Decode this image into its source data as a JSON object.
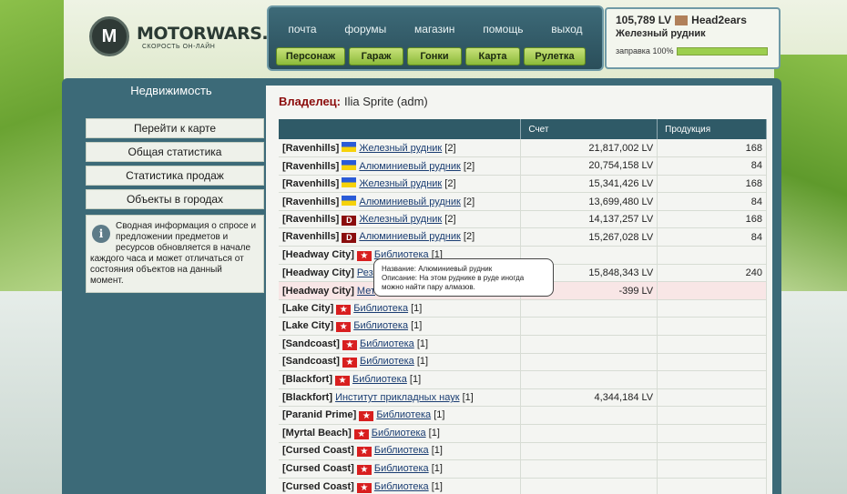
{
  "logo": {
    "mark": "M",
    "name": "MOTORWARS.RU",
    "tagline": "СКОРОСТЬ ОН-ЛАЙН"
  },
  "topnav": {
    "links": [
      "почта",
      "форумы",
      "магазин",
      "помощь",
      "выход"
    ],
    "buttons": [
      "Персонаж",
      "Гараж",
      "Гонки",
      "Карта",
      "Рулетка"
    ]
  },
  "user": {
    "balance": "105,789 LV",
    "name": "Head2ears",
    "location": "Железный рудник",
    "fuel_label": "заправка 100%",
    "fuel_percent": 100
  },
  "sidebar": {
    "title": "Недвижимость",
    "items": [
      "Перейти к карте",
      "Общая статистика",
      "Статистика продаж",
      "Объекты в городах"
    ],
    "info_icon": "i",
    "info_text": "Сводная информация о спросе и предложении предметов и ресурсов обновляется в начале каждого часа и может отличаться от состояния объектов на данный момент."
  },
  "owner": {
    "label": "Владелец:",
    "name": "Ilia Sprite (adm)"
  },
  "table": {
    "headers": [
      "",
      "Счет",
      "Продукция"
    ],
    "rows": [
      {
        "city": "[Ravenhills]",
        "flag": "ua",
        "name": "Железный рудник",
        "count": "[2]",
        "score": "21,817,002 LV",
        "prod": "168"
      },
      {
        "city": "[Ravenhills]",
        "flag": "ua",
        "name": "Алюминиевый рудник",
        "count": "[2]",
        "score": "20,754,158 LV",
        "prod": "84"
      },
      {
        "city": "[Ravenhills]",
        "flag": "ua",
        "name": "Железный рудник",
        "count": "[2]",
        "score": "15,341,426 LV",
        "prod": "168"
      },
      {
        "city": "[Ravenhills]",
        "flag": "ua",
        "name": "Алюминиевый рудник",
        "count": "[2]",
        "score": "13,699,480 LV",
        "prod": "84"
      },
      {
        "city": "[Ravenhills]",
        "flag": "d",
        "name": "Железный рудник",
        "count": "[2]",
        "score": "14,137,257 LV",
        "prod": "168"
      },
      {
        "city": "[Ravenhills]",
        "flag": "d",
        "name": "Алюминиевый рудник",
        "count": "[2]",
        "score": "15,267,028 LV",
        "prod": "84"
      },
      {
        "city": "[Headway City]",
        "flag": "star",
        "name": "Библиотека",
        "count": "[1]",
        "score": "",
        "prod": ""
      },
      {
        "city": "[Headway City]",
        "flag": "",
        "name": "Рез",
        "count": "",
        "score": "15,848,343 LV",
        "prod": "240"
      },
      {
        "city": "[Headway City]",
        "flag": "",
        "name": "Мет",
        "count": "",
        "score": "-399 LV",
        "prod": "",
        "pink": true
      },
      {
        "city": "[Lake City]",
        "flag": "star",
        "name": "Библиотека",
        "count": "[1]",
        "score": "",
        "prod": ""
      },
      {
        "city": "[Lake City]",
        "flag": "star",
        "name": "Библиотека",
        "count": "[1]",
        "score": "",
        "prod": ""
      },
      {
        "city": "[Sandcoast]",
        "flag": "star",
        "name": "Библиотека",
        "count": "[1]",
        "score": "",
        "prod": ""
      },
      {
        "city": "[Sandcoast]",
        "flag": "star",
        "name": "Библиотека",
        "count": "[1]",
        "score": "",
        "prod": ""
      },
      {
        "city": "[Blackfort]",
        "flag": "star",
        "name": "Библиотека",
        "count": "[1]",
        "score": "",
        "prod": ""
      },
      {
        "city": "[Blackfort]",
        "flag": "",
        "name": "Институт прикладных наук",
        "count": "[1]",
        "score": "4,344,184 LV",
        "prod": ""
      },
      {
        "city": "[Paranid Prime]",
        "flag": "star",
        "name": "Библиотека",
        "count": "[1]",
        "score": "",
        "prod": ""
      },
      {
        "city": "[Myrtal Beach]",
        "flag": "star",
        "name": "Библиотека",
        "count": "[1]",
        "score": "",
        "prod": ""
      },
      {
        "city": "[Cursed Coast]",
        "flag": "star",
        "name": "Библиотека",
        "count": "[1]",
        "score": "",
        "prod": ""
      },
      {
        "city": "[Cursed Coast]",
        "flag": "star",
        "name": "Библиотека",
        "count": "[1]",
        "score": "",
        "prod": ""
      },
      {
        "city": "[Cursed Coast]",
        "flag": "star",
        "name": "Библиотека",
        "count": "[1]",
        "score": "",
        "prod": ""
      }
    ]
  },
  "tooltip": {
    "line1": "Название: Алюминиевый рудник",
    "line2": "Описание: На этом руднике в руде иногда можно найти пару алмазов."
  },
  "colors": {
    "nav_bg": "#2a4e5a",
    "accent_green": "#8cba3a",
    "owner_label": "#8b0b0b"
  }
}
